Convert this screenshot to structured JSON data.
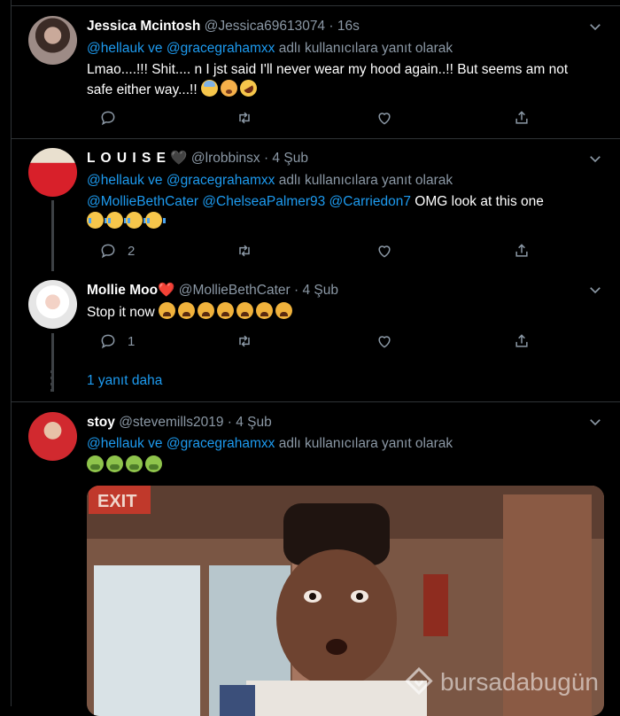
{
  "tweets": [
    {
      "name": "Jessica Mcintosh",
      "handle": "@Jessica69613074",
      "time": "· 16s",
      "reply_mentions": "@hellauk ve @gracegrahamxx",
      "reply_suffix": " adlı kullanıcılara yanıt olarak",
      "text_line1": "Lmao....!!! Shit.... n I jst said I'll never wear my hood again..!! But seems am not",
      "text_line2": "safe either way...!! ",
      "emojis": [
        "fearful-face-emoji",
        "flushed-face-emoji",
        "rofl-emoji"
      ]
    },
    {
      "name": "L O U I S E",
      "heart": "🖤",
      "handle": "@lrobbinsx",
      "time": "· 4 Şub",
      "reply_mentions": "@hellauk ve @gracegrahamxx",
      "reply_suffix": " adlı kullanıcılara yanıt olarak",
      "mention_line": "@MollieBethCater @ChelseaPalmer93 @Carriedon7",
      "text": " OMG look at this one",
      "emojis": [
        "sob-emoji",
        "sob-emoji",
        "sob-emoji",
        "sob-emoji"
      ],
      "reply_count": "2"
    },
    {
      "name": "Mollie Moo",
      "heart": "❤️",
      "handle": "@MollieBethCater",
      "time": "· 4 Şub",
      "text": "Stop it now ",
      "emojis": [
        "weary-emoji",
        "weary-emoji",
        "weary-emoji",
        "weary-emoji",
        "weary-emoji",
        "weary-emoji",
        "weary-emoji"
      ],
      "reply_count": "1"
    },
    {
      "name": "stoy",
      "handle": "@stevemills2019",
      "time": "· 4 Şub",
      "reply_mentions": "@hellauk ve @gracegrahamxx",
      "reply_suffix": " adlı kullanıcılara yanıt olarak",
      "emojis": [
        "nauseated-emoji",
        "nauseated-emoji",
        "nauseated-emoji",
        "nauseated-emoji"
      ],
      "gif_sign": "EXIT"
    }
  ],
  "show_more": "1 yanıt daha",
  "watermark": "bursadabugün",
  "colors": {
    "background": "#000000",
    "link": "#1d9bf0",
    "muted": "#8b98a5",
    "divider": "#2f3336"
  },
  "icons": [
    "reply-icon",
    "retweet-icon",
    "like-icon",
    "share-icon",
    "caret-down-icon"
  ]
}
